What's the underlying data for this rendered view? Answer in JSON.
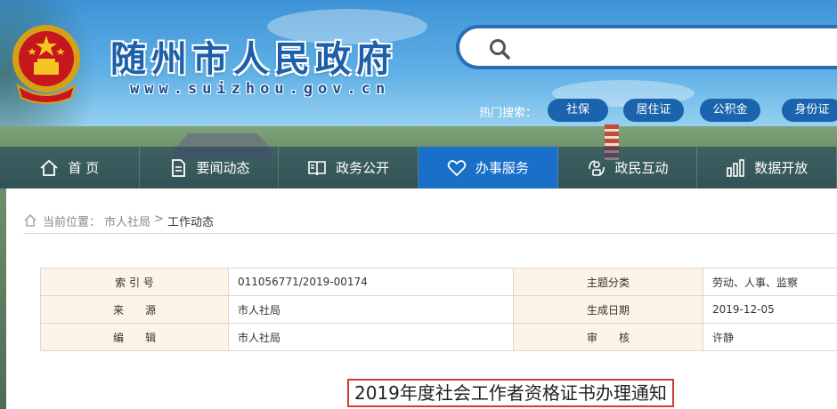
{
  "header": {
    "site_title": "随州市人民政府",
    "site_domain": "www.suizhou.gov.cn"
  },
  "search": {
    "value": "",
    "placeholder": ""
  },
  "hot_search": {
    "label": "热门搜索：",
    "tags": [
      "社保",
      "居住证",
      "公积金",
      "身份证"
    ]
  },
  "nav": {
    "items": [
      {
        "label": "首 页",
        "icon": "home-icon"
      },
      {
        "label": "要闻动态",
        "icon": "document-icon"
      },
      {
        "label": "政务公开",
        "icon": "book-icon"
      },
      {
        "label": "办事服务",
        "icon": "heart-icon"
      },
      {
        "label": "政民互动",
        "icon": "interaction-icon"
      },
      {
        "label": "数据开放",
        "icon": "bar-chart-icon"
      }
    ],
    "active_index": 3
  },
  "breadcrumb": {
    "prefix": "当前位置：",
    "parent": "市人社局",
    "separator": ">",
    "current": "工作动态"
  },
  "meta": {
    "rows": [
      {
        "label1": "索 引 号",
        "value1": "011056771/2019-00174",
        "label2": "主题分类",
        "value2": "劳动、人事、监察"
      },
      {
        "label1": "来　　源",
        "value1": "市人社局",
        "label2": "生成日期",
        "value2": "2019-12-05"
      },
      {
        "label1": "编　　辑",
        "value1": "市人社局",
        "label2": "审　　核",
        "value2": "许静"
      }
    ]
  },
  "article": {
    "title": "2019年度社会工作者资格证书办理通知"
  },
  "colors": {
    "brand_blue": "#1b63ad",
    "nav_active": "#1a6fc8",
    "title_box_border": "#d23a3a",
    "label_cell_bg": "#fdf3e6"
  }
}
